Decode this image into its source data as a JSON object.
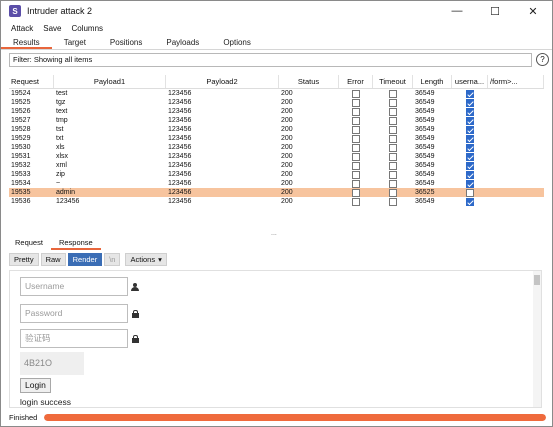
{
  "window": {
    "title": "Intruder attack 2",
    "minimize": "—",
    "maximize": "☐",
    "close": "✕"
  },
  "menu": [
    "Attack",
    "Save",
    "Columns"
  ],
  "tabs": [
    "Results",
    "Target",
    "Positions",
    "Payloads",
    "Options"
  ],
  "active_tab": "Results",
  "filter_text": "Filter: Showing all items",
  "help": "?",
  "columns": [
    "Request",
    "Payload1",
    "Payload2",
    "Status",
    "Error",
    "Timeout",
    "Length",
    "userna...",
    "/form>..."
  ],
  "rows": [
    {
      "request": "19524",
      "payload1": "test",
      "payload2": "123456",
      "status": "200",
      "length": "36549",
      "match": true,
      "selected": false
    },
    {
      "request": "19525",
      "payload1": "tgz",
      "payload2": "123456",
      "status": "200",
      "length": "36549",
      "match": true,
      "selected": false
    },
    {
      "request": "19526",
      "payload1": "text",
      "payload2": "123456",
      "status": "200",
      "length": "36549",
      "match": true,
      "selected": false
    },
    {
      "request": "19527",
      "payload1": "tmp",
      "payload2": "123456",
      "status": "200",
      "length": "36549",
      "match": true,
      "selected": false
    },
    {
      "request": "19528",
      "payload1": "tst",
      "payload2": "123456",
      "status": "200",
      "length": "36549",
      "match": true,
      "selected": false
    },
    {
      "request": "19529",
      "payload1": "txt",
      "payload2": "123456",
      "status": "200",
      "length": "36549",
      "match": true,
      "selected": false
    },
    {
      "request": "19530",
      "payload1": "xls",
      "payload2": "123456",
      "status": "200",
      "length": "36549",
      "match": true,
      "selected": false
    },
    {
      "request": "19531",
      "payload1": "xlsx",
      "payload2": "123456",
      "status": "200",
      "length": "36549",
      "match": true,
      "selected": false
    },
    {
      "request": "19532",
      "payload1": "xml",
      "payload2": "123456",
      "status": "200",
      "length": "36549",
      "match": true,
      "selected": false
    },
    {
      "request": "19533",
      "payload1": "zip",
      "payload2": "123456",
      "status": "200",
      "length": "36549",
      "match": true,
      "selected": false
    },
    {
      "request": "19534",
      "payload1": "~",
      "payload2": "123456",
      "status": "200",
      "length": "36549",
      "match": true,
      "selected": false
    },
    {
      "request": "19535",
      "payload1": "admin",
      "payload2": "123456",
      "status": "200",
      "length": "36525",
      "match": false,
      "selected": true
    },
    {
      "request": "19536",
      "payload1": "123456",
      "payload2": "123456",
      "status": "200",
      "length": "36549",
      "match": true,
      "selected": false
    }
  ],
  "splitter": "...",
  "subtabs": [
    "Request",
    "Response"
  ],
  "active_subtab": "Response",
  "toolbar": {
    "pretty": "Pretty",
    "raw": "Raw",
    "render": "Render",
    "newline": "\\n",
    "actions": "Actions",
    "actions_caret": "▾"
  },
  "render_view": {
    "username_placeholder": "Username",
    "password_placeholder": "Password",
    "captcha_placeholder": "验证码",
    "captcha_code": "4B21O",
    "login_button": "Login",
    "login_message": "login success"
  },
  "status": {
    "text": "Finished",
    "progress": 1.0
  },
  "colors": {
    "accent": "#e8663c",
    "selected_row": "#f7c49e",
    "checkbox": "#2d69c9",
    "progress": "#ef6a3c"
  }
}
